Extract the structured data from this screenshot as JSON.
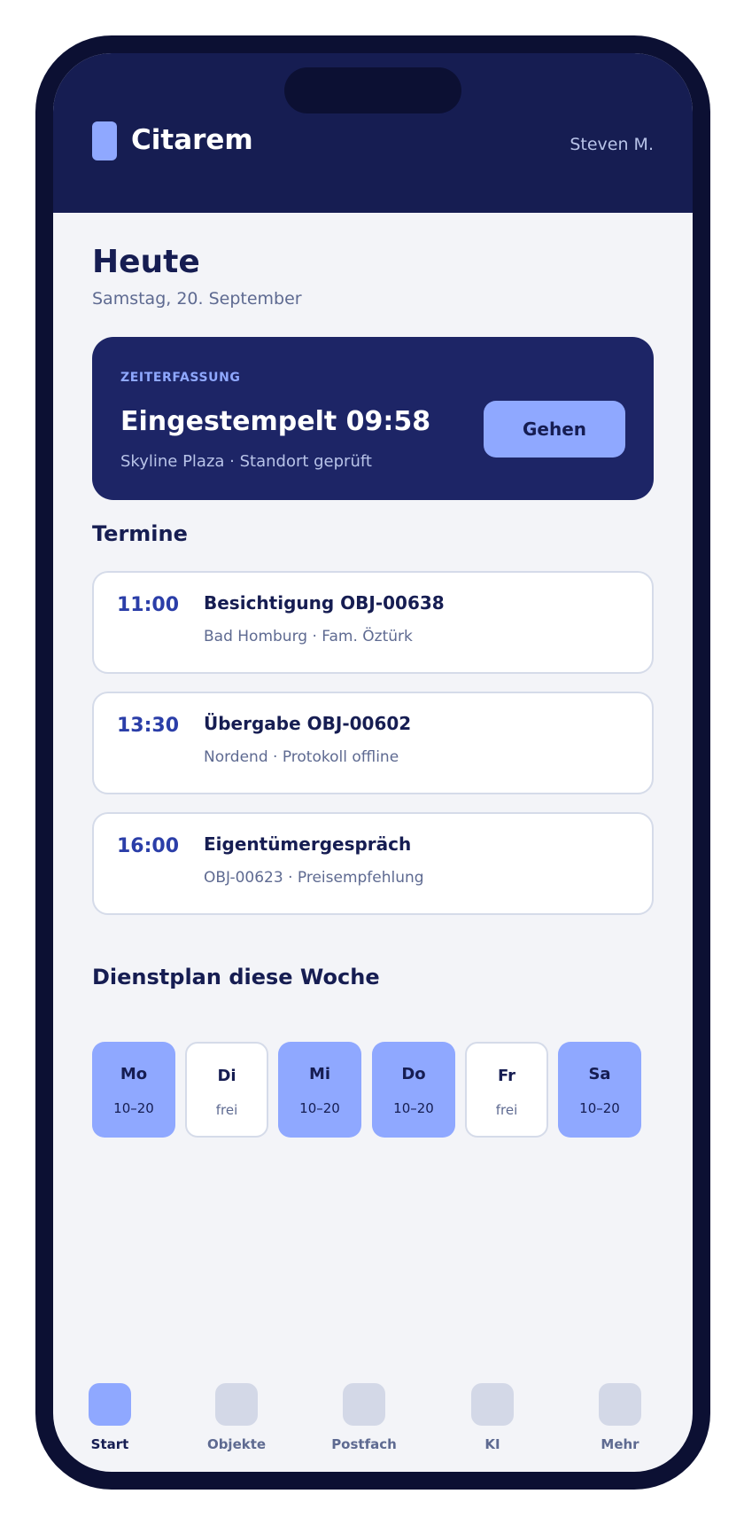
{
  "header": {
    "brand": "Citarem",
    "user": "Steven M.",
    "logo_icon": "app-logo-mark"
  },
  "today": {
    "title": "Heute",
    "date": "Samstag, 20. September"
  },
  "time_tracking": {
    "eyebrow": "ZEITERFASSUNG",
    "status": "Eingestempelt 09:58",
    "location": "Skyline Plaza · Standort geprüft",
    "action_label": "Gehen"
  },
  "appointments": {
    "title": "Termine",
    "items": [
      {
        "time": "11:00",
        "title": "Besichtigung OBJ-00638",
        "subtitle": "Bad Homburg · Fam. Öztürk"
      },
      {
        "time": "13:30",
        "title": "Übergabe OBJ-00602",
        "subtitle": "Nordend · Protokoll offline"
      },
      {
        "time": "16:00",
        "title": "Eigentümergespräch",
        "subtitle": "OBJ-00623 · Preisempfehlung"
      }
    ]
  },
  "schedule": {
    "title": "Dienstplan diese Woche",
    "days": [
      {
        "day": "Mo",
        "hours": "10–20",
        "working": true
      },
      {
        "day": "Di",
        "hours": "frei",
        "working": false
      },
      {
        "day": "Mi",
        "hours": "10–20",
        "working": true
      },
      {
        "day": "Do",
        "hours": "10–20",
        "working": true
      },
      {
        "day": "Fr",
        "hours": "frei",
        "working": false
      },
      {
        "day": "Sa",
        "hours": "10–20",
        "working": true
      }
    ]
  },
  "tabs": [
    {
      "label": "Start",
      "active": true,
      "icon": "home-icon"
    },
    {
      "label": "Objekte",
      "active": false,
      "icon": "properties-icon"
    },
    {
      "label": "Postfach",
      "active": false,
      "icon": "inbox-icon"
    },
    {
      "label": "KI",
      "active": false,
      "icon": "ai-icon"
    },
    {
      "label": "Mehr",
      "active": false,
      "icon": "more-icon"
    }
  ],
  "colors": {
    "navy": "#161d52",
    "card_navy": "#1d2566",
    "accent": "#8fa8ff",
    "time_blue": "#2b3ea8",
    "muted_text": "#5e6a91",
    "background": "#f3f4f8"
  }
}
